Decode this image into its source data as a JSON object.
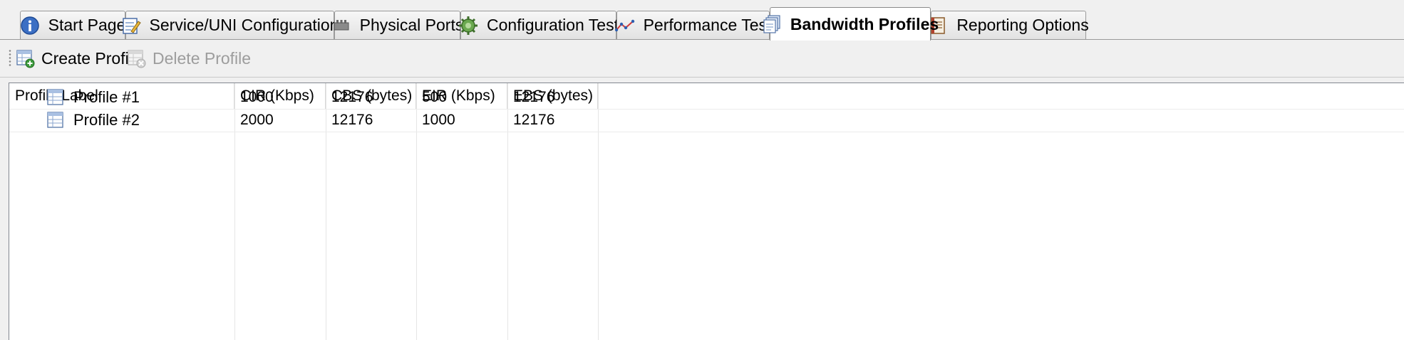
{
  "tabs": [
    {
      "label": "Start Page",
      "icon": "info-icon"
    },
    {
      "label": "Service/UNI Configuration",
      "icon": "edit-form-icon"
    },
    {
      "label": "Physical Ports",
      "icon": "network-port-icon"
    },
    {
      "label": "Configuration Test",
      "icon": "gear-bug-icon"
    },
    {
      "label": "Performance Test",
      "icon": "line-graph-icon"
    },
    {
      "label": "Bandwidth Profiles",
      "icon": "stacked-pages-icon",
      "active": true
    },
    {
      "label": "Reporting Options",
      "icon": "notebook-icon"
    }
  ],
  "toolbar": {
    "create_label": "Create Profile",
    "delete_label": "Delete Profile"
  },
  "table": {
    "columns": [
      "Profile Label",
      "CIR (Kbps)",
      "CBS (bytes)",
      "EIR (Kbps)",
      "EBS (bytes)"
    ],
    "rows": [
      {
        "label": "Profile #1",
        "cir": "1000",
        "cbs": "12176",
        "eir": "500",
        "ebs": "12176"
      },
      {
        "label": "Profile #2",
        "cir": "2000",
        "cbs": "12176",
        "eir": "1000",
        "ebs": "12176"
      }
    ]
  },
  "colors": {
    "active_tab_bg": "#ffffff",
    "disabled_text": "#9d9d9d",
    "grid_border": "#828790"
  }
}
